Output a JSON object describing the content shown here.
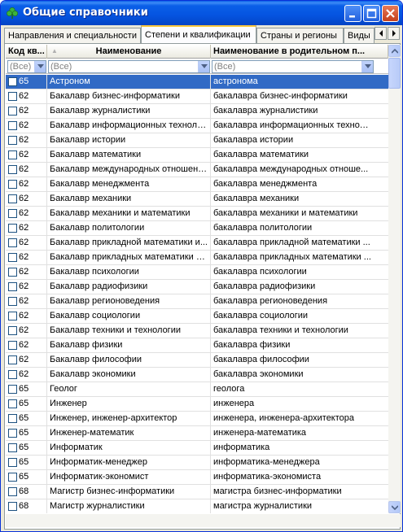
{
  "window": {
    "title": "Общие справочники",
    "icon": "clover-icon"
  },
  "tabs": [
    {
      "label": "Направления и специальности",
      "active": false
    },
    {
      "label": "Степени и квалификации",
      "active": true
    },
    {
      "label": "Страны и регионы",
      "active": false
    },
    {
      "label": "Виды",
      "active": false
    }
  ],
  "grid": {
    "columns": [
      "Код кв...",
      "Наименование",
      "Наименование в родительном п..."
    ],
    "filters": [
      "(Все)",
      "(Все)",
      "(Все)"
    ],
    "selection_color": "#316ac5",
    "rows": [
      {
        "code": "65",
        "name": "Астроном",
        "parent": "астронома",
        "selected": true
      },
      {
        "code": "62",
        "name": "Бакалавр бизнес-информатики",
        "parent": "бакалавра бизнес-информатики"
      },
      {
        "code": "62",
        "name": "Бакалавр журналистики",
        "parent": "бакалавра журналистики"
      },
      {
        "code": "62",
        "name": "Бакалавр информационных техноло...",
        "parent": "бакалавра информационных техноло..."
      },
      {
        "code": "62",
        "name": "Бакалавр истории",
        "parent": "бакалавра истории"
      },
      {
        "code": "62",
        "name": "Бакалавр математики",
        "parent": "бакалавра математики"
      },
      {
        "code": "62",
        "name": "Бакалавр международных отношений",
        "parent": "бакалавра международных отноше..."
      },
      {
        "code": "62",
        "name": "Бакалавр менеджмента",
        "parent": "бакалавра менеджмента"
      },
      {
        "code": "62",
        "name": "Бакалавр механики",
        "parent": "бакалавра механики"
      },
      {
        "code": "62",
        "name": "Бакалавр механики и математики",
        "parent": "бакалавра механики и математики"
      },
      {
        "code": "62",
        "name": "Бакалавр политологии",
        "parent": "бакалавра политологии"
      },
      {
        "code": "62",
        "name": "Бакалавр прикладной математики и...",
        "parent": "бакалавра прикладной математики ..."
      },
      {
        "code": "62",
        "name": "Бакалавр прикладных математики и...",
        "parent": "бакалавра прикладных математики ..."
      },
      {
        "code": "62",
        "name": "Бакалавр психологии",
        "parent": "бакалавра психологии"
      },
      {
        "code": "62",
        "name": "Бакалавр радиофизики",
        "parent": "бакалавра радиофизики"
      },
      {
        "code": "62",
        "name": "Бакалавр регионоведения",
        "parent": "бакалавра регионоведения"
      },
      {
        "code": "62",
        "name": "Бакалавр социологии",
        "parent": "бакалавра социологии"
      },
      {
        "code": "62",
        "name": "Бакалавр техники и технологии",
        "parent": "бакалавра техники и технологии"
      },
      {
        "code": "62",
        "name": "Бакалавр физики",
        "parent": "бакалавра физики"
      },
      {
        "code": "62",
        "name": "Бакалавр философии",
        "parent": "бакалавра философии"
      },
      {
        "code": "62",
        "name": "Бакалавр экономики",
        "parent": "бакалавра экономики"
      },
      {
        "code": "65",
        "name": "Геолог",
        "parent": "геолога"
      },
      {
        "code": "65",
        "name": "Инженер",
        "parent": "инженера"
      },
      {
        "code": "65",
        "name": "Инженер, инженер-архитектор",
        "parent": "инженера, инженера-архитектора"
      },
      {
        "code": "65",
        "name": "Инженер-математик",
        "parent": "инженера-математика"
      },
      {
        "code": "65",
        "name": "Информатик",
        "parent": "информатика"
      },
      {
        "code": "65",
        "name": "Информатик-менеджер",
        "parent": "информатика-менеджера"
      },
      {
        "code": "65",
        "name": "Информатик-экономист",
        "parent": "информатика-экономиста"
      },
      {
        "code": "68",
        "name": "Магистр бизнес-информатики",
        "parent": "магистра бизнес-информатики"
      },
      {
        "code": "68",
        "name": "Магистр журналистики",
        "parent": "магистра журналистики"
      }
    ]
  }
}
